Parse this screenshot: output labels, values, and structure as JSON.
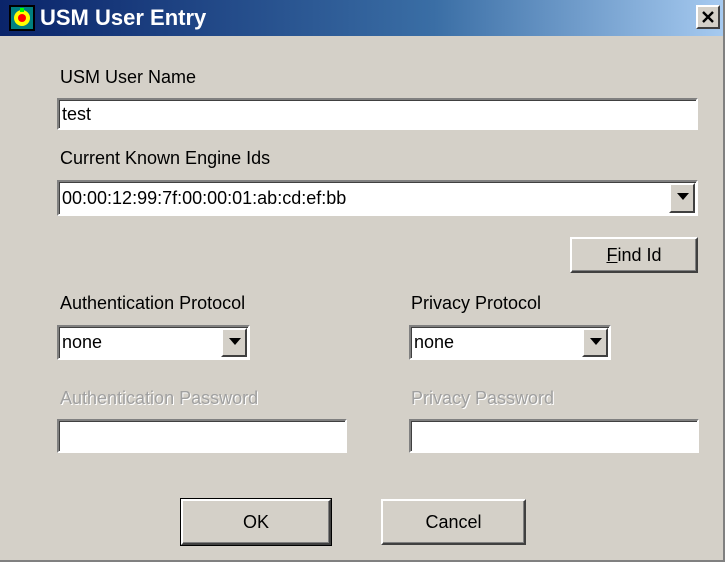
{
  "window": {
    "title": "USM User Entry"
  },
  "form": {
    "user_name_label": "USM User Name",
    "user_name_value": "test",
    "engine_ids_label": "Current Known Engine Ids",
    "engine_id_selected": "00:00:12:99:7f:00:00:01:ab:cd:ef:bb",
    "find_id_label": "Find Id",
    "auth_protocol_label": "Authentication Protocol",
    "auth_protocol_selected": "none",
    "privacy_protocol_label": "Privacy Protocol",
    "privacy_protocol_selected": "none",
    "auth_password_label": "Authentication Password",
    "auth_password_value": "",
    "privacy_password_label": "Privacy Password",
    "privacy_password_value": ""
  },
  "buttons": {
    "ok_label": "OK",
    "cancel_label": "Cancel"
  },
  "colors": {
    "face": "#d4d0c8",
    "title_start": "#0a246a",
    "title_end": "#a6caf0",
    "disabled_text": "#a0a0a0"
  },
  "icons": {
    "app": "app-icon",
    "close": "close-icon",
    "dropdown": "chevron-down-icon"
  }
}
